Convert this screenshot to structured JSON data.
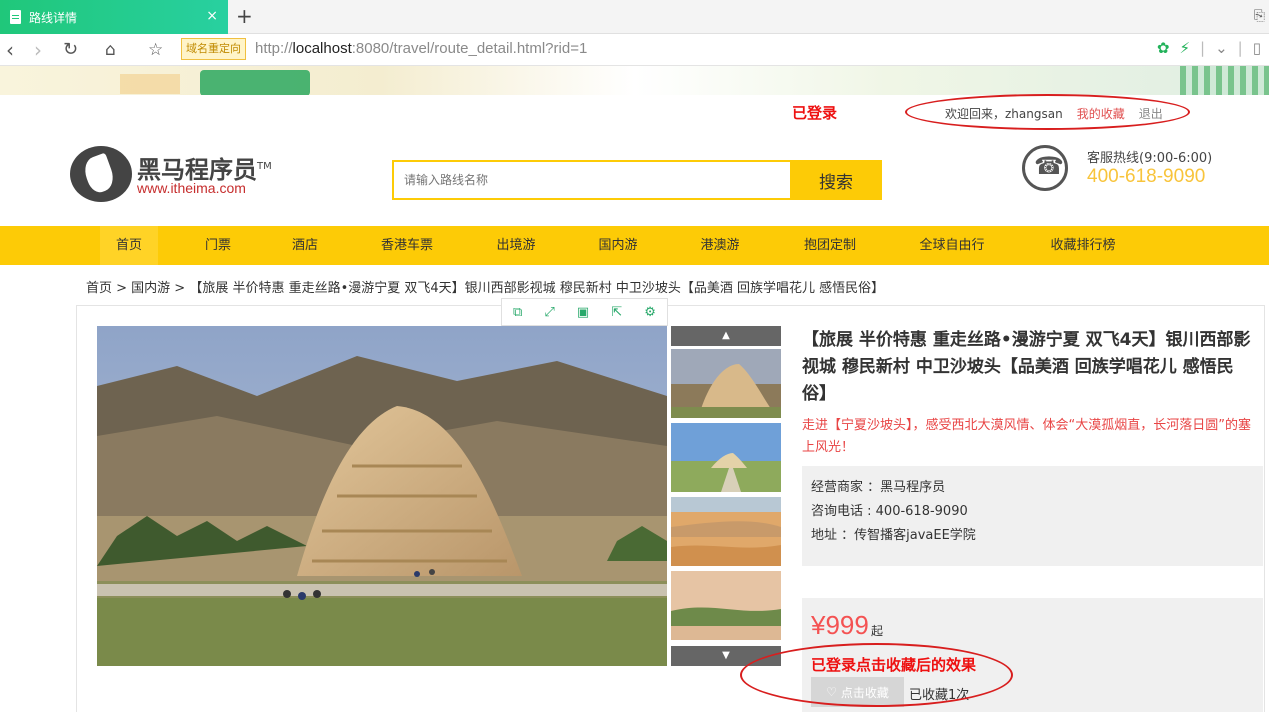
{
  "browser": {
    "tab_title": "路线详情",
    "tab_close": "×",
    "new_tab": "+",
    "redirect_tag": "域名重定向",
    "url_host": "localhost",
    "url_prefix": "http://",
    "url_rest": ":8080/travel/route_detail.html?rid=1"
  },
  "header": {
    "login_annotation": "已登录",
    "welcome": "欢迎回来，zhangsan",
    "my_favorites": "我的收藏",
    "logout": "退出",
    "logo_name": "黑马程序员",
    "logo_tm": "TM",
    "logo_url": "www.itheima.com",
    "search_placeholder": "请输入路线名称",
    "search_button": "搜索",
    "hotline_label": "客服热线(9:00-6:00)",
    "hotline_number": "400-618-9090"
  },
  "nav": {
    "items": [
      "首页",
      "门票",
      "酒店",
      "香港车票",
      "出境游",
      "国内游",
      "港澳游",
      "抱团定制",
      "全球自由行",
      "收藏排行榜"
    ],
    "active_index": 0
  },
  "breadcrumb": "首页 > 国内游 > 【旅展 半价特惠 重走丝路•漫游宁夏 双飞4天】银川西部影视城 穆民新村 中卫沙坡头【品美酒 回族学唱花儿 感悟民俗】",
  "route": {
    "title": "【旅展 半价特惠 重走丝路•漫游宁夏 双飞4天】银川西部影视城 穆民新村 中卫沙坡头【品美酒 回族学唱花儿 感悟民俗】",
    "subtitle": "走进【宁夏沙坡头】，感受西北大漠风情、体会“大漠孤烟直，长河落日圆”的塞上风光！",
    "merchant_label": "经营商家 ：",
    "merchant_value": "黑马程序员",
    "phone_label": "咨询电话 : ",
    "phone_value": "400-618-9090",
    "address_label": "地址 ：",
    "address_value": "传智播客javaEE学院",
    "price": "¥999",
    "price_suffix": "起",
    "fav_annotation": "已登录点击收藏后的效果",
    "fav_button": "点击收藏",
    "fav_count": "已收藏1次"
  },
  "colors": {
    "accent_yellow": "#fdcb06",
    "price_red": "#f45252",
    "annotation_red": "#d81e1e"
  }
}
